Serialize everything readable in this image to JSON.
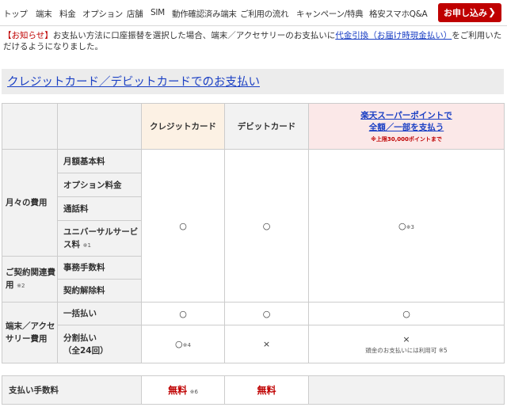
{
  "nav": {
    "items": [
      "トップ",
      "端末",
      "料金",
      "オプション",
      "店舗",
      "SIM",
      "動作確認済み端末",
      "ご利用の流れ",
      "キャンペーン/特典",
      "格安スマホQ&A"
    ],
    "apply_label": "お申し込み",
    "apply_chevron": "❯"
  },
  "notice": {
    "tag": "【お知らせ】",
    "text_before": "お支払い方法に口座振替を選択した場合、端末／アクセサリーのお支払いに",
    "link": "代金引換（お届け時現金払い）",
    "text_after": "をご利用いただけるようになりました。"
  },
  "section": {
    "title": "クレジットカード／デビットカードでのお支払い"
  },
  "table": {
    "headers": {
      "credit": "クレジットカード",
      "debit": "デビットカード",
      "point_line1": "楽天スーパーポイントで",
      "point_line2": "全額／一部を支払う",
      "point_note": "※上限30,000ポイントまで"
    },
    "monthly": {
      "category": "月々の費用",
      "items": [
        "月額基本料",
        "オプション料金",
        "通話料",
        "ユニバーサルサービス料"
      ],
      "universal_note": "※1"
    },
    "contract": {
      "category": "ご契約関連費用",
      "category_note": "※2",
      "items": [
        "事務手数料",
        "契約解除料"
      ]
    },
    "device": {
      "category": "端末／アクセサリー費用",
      "lump_sum": "一括払い",
      "installment_line1": "分割払い",
      "installment_line2": "（全24回）"
    },
    "marks": {
      "ok": "○",
      "ng": "×",
      "note3": "※3",
      "note4": "※4",
      "cash_note": "頭金のお支払いには利用可 ※5"
    }
  },
  "fee_table": {
    "label": "支払い手数料",
    "credit": "無料",
    "credit_note": "※6",
    "debit": "無料"
  },
  "colors": {
    "accent_red": "#bf0000",
    "link_blue": "#1a3fc4",
    "credit_bg": "#fcf1e4",
    "point_bg": "#fbe8e8"
  }
}
